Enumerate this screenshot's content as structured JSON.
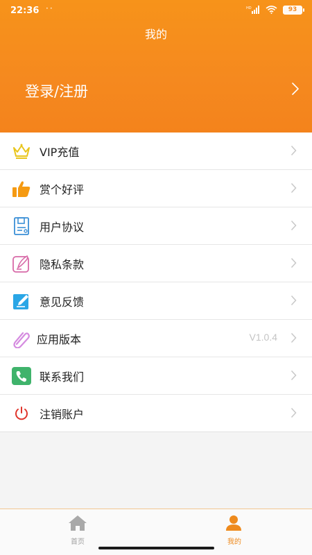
{
  "status_bar": {
    "time": "22:36",
    "dots": "··",
    "battery": "93"
  },
  "header": {
    "title": "我的",
    "login_label": "登录/注册"
  },
  "menu": {
    "items": [
      {
        "label": "VIP充值",
        "icon": "crown-icon"
      },
      {
        "label": "赏个好评",
        "icon": "thumbs-up-icon"
      },
      {
        "label": "用户协议",
        "icon": "document-icon"
      },
      {
        "label": "隐私条款",
        "icon": "edit-note-icon"
      },
      {
        "label": "意见反馈",
        "icon": "feedback-pencil-icon"
      },
      {
        "label": "应用版本",
        "icon": "paperclip-icon",
        "value": "V1.0.4"
      },
      {
        "label": "联系我们",
        "icon": "phone-icon"
      },
      {
        "label": "注销账户",
        "icon": "power-icon"
      }
    ]
  },
  "tab_bar": {
    "home_label": "首页",
    "mine_label": "我的",
    "active_color": "#ee8a1d",
    "inactive_color": "#a0a0a0"
  },
  "colors": {
    "header_orange": "#f5891f",
    "accent": "#ee8a1d"
  }
}
